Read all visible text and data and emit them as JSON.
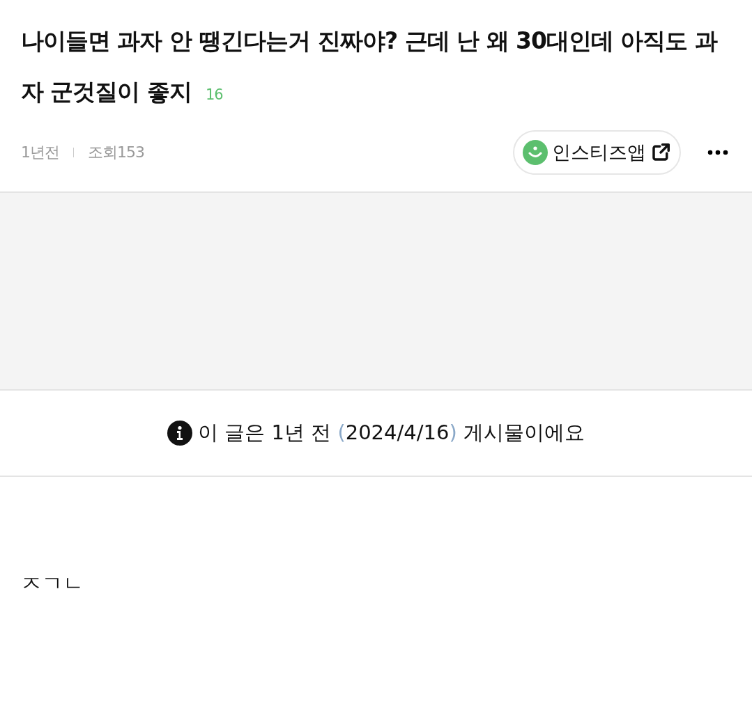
{
  "post": {
    "title": "나이들면 과자 안 땡긴다는거 진짜야? 근데 난 왜 30대인데 아직도 과자 군것질이 좋지",
    "comment_count": "16",
    "time": "1년전",
    "views": "조회153",
    "app_button": "인스티즈앱"
  },
  "notice": {
    "before": "이 글은 1년 전 ",
    "open": "(",
    "date": "2024/4/16",
    "close": ")",
    "after": " 게시물이에요"
  },
  "body": "ㅈㄱㄴ"
}
